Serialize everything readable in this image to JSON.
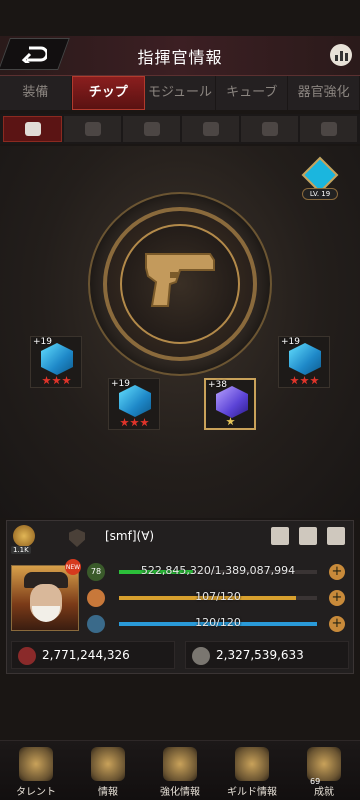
{
  "header": {
    "title": "指揮官情報"
  },
  "tabs": [
    {
      "label": "装備",
      "active": false
    },
    {
      "label": "チップ",
      "active": true
    },
    {
      "label": "モジュール",
      "active": false
    },
    {
      "label": "キューブ",
      "active": false
    },
    {
      "label": "器官強化",
      "active": false
    }
  ],
  "categories": [
    "pistol-icon",
    "armor-icon",
    "ammo-icon",
    "gasmask-icon",
    "vest-icon",
    "boot-icon"
  ],
  "stage": {
    "level_badge": "LV. 19",
    "chips": [
      {
        "plus": "+19",
        "stars": 3,
        "color": "blue"
      },
      {
        "plus": "+19",
        "stars": 3,
        "color": "blue"
      },
      {
        "plus": "+38",
        "stars": 1,
        "color": "purple"
      },
      {
        "plus": "+19",
        "stars": 3,
        "color": "blue"
      }
    ]
  },
  "panel": {
    "power_small": "1.1K",
    "player_name": "[smf](∀)",
    "level": "78",
    "exp_text": "522,845,320/1,389,087,994",
    "exp_fraction": 0.376,
    "stamina_text": "107/120",
    "stamina_fraction": 0.892,
    "energy_text": "120/120",
    "energy_fraction": 1.0,
    "new_tag": "NEW",
    "resource_left": "2,771,244,326",
    "resource_right": "2,327,539,633"
  },
  "colors": {
    "exp": "#2cbf3a",
    "stamina": "#d8a02e",
    "energy": "#2a9ad8"
  },
  "nav": [
    {
      "label": "タレント"
    },
    {
      "label": "情報"
    },
    {
      "label": "強化情報"
    },
    {
      "label": "ギルド情報"
    },
    {
      "label": "成就",
      "count": "69"
    }
  ]
}
